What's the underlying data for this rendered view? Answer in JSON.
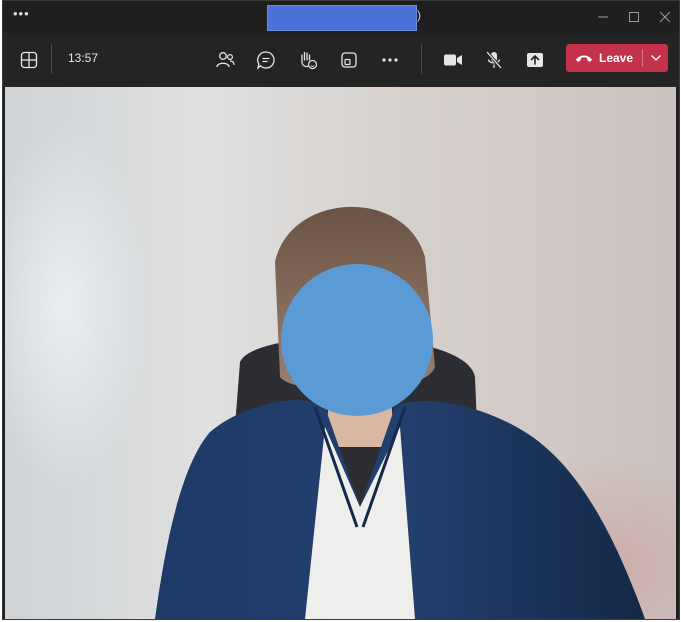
{
  "titlebar": {
    "menu_glyph": "•••",
    "title_trailing_glyph": ")"
  },
  "toolbar": {
    "elapsed_time": "13:57",
    "leave_label": "Leave"
  },
  "colors": {
    "leave_button": "#c4314b",
    "toolbar_bg": "#242424",
    "titlebar_bg": "#1f1f1f",
    "redaction": "#4c72d8",
    "face_redaction": "#5b9bd5"
  },
  "icons": [
    "grid-view-icon",
    "participants-icon",
    "chat-icon",
    "reactions-icon",
    "rooms-icon",
    "more-options-icon",
    "camera-icon",
    "mic-off-icon",
    "share-screen-icon",
    "phone-hangup-icon",
    "chevron-down-icon",
    "minimize-icon",
    "maximize-icon",
    "close-icon"
  ]
}
